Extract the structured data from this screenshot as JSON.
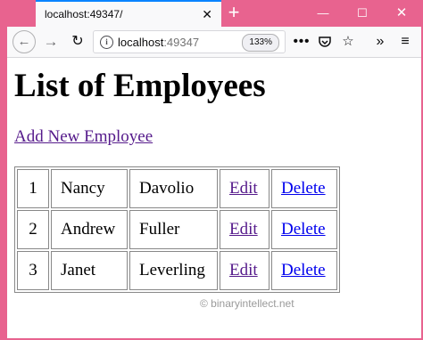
{
  "browser": {
    "tab_title": "localhost:49347/",
    "tab_close": "✕",
    "new_tab": "+",
    "win_min": "—",
    "win_max": "☐",
    "win_close": "✕",
    "url_host": "localhost",
    "url_port": ":49347",
    "zoom": "133%",
    "more": "•••",
    "pocket": "◡",
    "star": "☆",
    "overflow": "»",
    "menu": "≡"
  },
  "page": {
    "heading": "List of Employees",
    "add_link": "Add New Employee",
    "edit_label": "Edit",
    "delete_label": "Delete",
    "employees": [
      {
        "id": "1",
        "first": "Nancy",
        "last": "Davolio"
      },
      {
        "id": "2",
        "first": "Andrew",
        "last": "Fuller"
      },
      {
        "id": "3",
        "first": "Janet",
        "last": "Leverling"
      }
    ],
    "watermark": "© binaryintellect.net"
  }
}
